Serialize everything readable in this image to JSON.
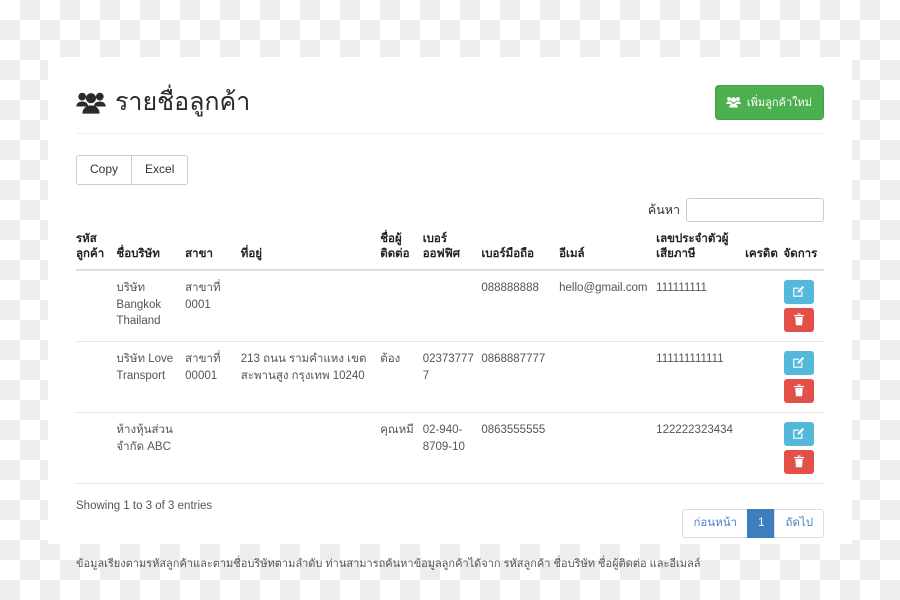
{
  "header": {
    "title": "รายชื่อลูกค้า",
    "title_icon": "users-icon",
    "add_button_label": "เพิ่มลูกค้าใหม่",
    "add_button_icon": "users-icon",
    "add_button_color": "#4caf50"
  },
  "toolbar": {
    "copy_label": "Copy",
    "excel_label": "Excel"
  },
  "search": {
    "label": "ค้นหา",
    "value": "",
    "placeholder": ""
  },
  "table": {
    "columns": [
      "รหัสลูกค้า",
      "ชื่อบริษัท",
      "สาขา",
      "ที่อยู่",
      "ชื่อผู้ติดต่อ",
      "เบอร์ออฟฟิศ",
      "เบอร์มือถือ",
      "อีเมล์",
      "เลขประจำตัวผู้เสียภาษี",
      "เครดิต",
      "จัดการ"
    ],
    "rows": [
      {
        "code": "",
        "company": "บริษัท Bangkok Thailand",
        "branch": "สาขาที่ 0001",
        "address": "",
        "contact": "",
        "office_phone": "",
        "mobile_phone": "088888888",
        "email": "hello@gmail.com",
        "tax_id": "111111111",
        "credit": "",
        "edit_icon": "edit-square-icon",
        "delete_icon": "trash-icon"
      },
      {
        "code": "",
        "company": "บริษัท Love Transport",
        "branch": "สาขาที่ 00001",
        "address": "213 ถนน รามคำแหง เขตสะพานสูง กรุงเทพ 10240",
        "contact": "ต้อง",
        "office_phone": "023737777",
        "mobile_phone": "0868887777",
        "email": "",
        "tax_id": "111111111111",
        "credit": "",
        "edit_icon": "edit-square-icon",
        "delete_icon": "trash-icon"
      },
      {
        "code": "",
        "company": "ห้างหุ้นส่วนจำกัด ABC",
        "branch": "",
        "address": "",
        "contact": "คุณหมี",
        "office_phone": "02-940-8709-10",
        "mobile_phone": "0863555555",
        "email": "",
        "tax_id": "122222323434",
        "credit": "",
        "edit_icon": "edit-square-icon",
        "delete_icon": "trash-icon"
      }
    ]
  },
  "footer": {
    "entries_info": "Showing 1 to 3 of 3 entries",
    "pagination": {
      "previous_label": "ก่อนหน้า",
      "page_1_label": "1",
      "next_label": "ถัดไป",
      "active_color": "#3d7ebf"
    },
    "note": "ข้อมูลเรียงตามรหัสลูกค้าและตามชื่อบริษัทตามลำดับ ท่านสามารถค้นหาข้อมูลลูกค้าได้จาก รหัสลูกค้า ชื่อบริษัท ชื่อผู้ติดต่อ และอีเมลล์"
  },
  "colors": {
    "edit_button": "#53b9db",
    "delete_button": "#e3504a",
    "add_button": "#4caf50"
  }
}
